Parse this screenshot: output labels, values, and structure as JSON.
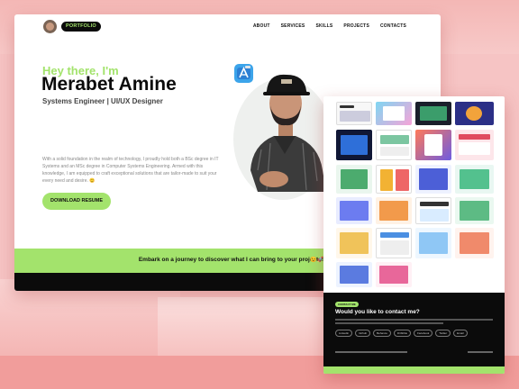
{
  "nav": {
    "brand": "PORTFOLIO",
    "links": [
      "ABOUT",
      "SERVICES",
      "SKILLS",
      "PROJECTS",
      "CONTACTS"
    ]
  },
  "hero": {
    "greeting": "Hey there, I'm",
    "name": "Merabet Amine",
    "role": "Systems Engineer | UI/UX Designer",
    "bio": "With a solid foundation in the realm of technology, I proudly hold both a BSc degree in IT Systems and an MSc degree in Computer Systems Engineering. Armed with this knowledge, I am equipped to craft exceptional solutions that are tailor-made to suit your every need and desire. 😊",
    "download_label": "DOWNLOAD RESUME"
  },
  "banner": {
    "text": "Embark on a journey to discover what I can bring to your projects!",
    "emoji": "😉🚀"
  },
  "contact": {
    "badge": "CONTACT ME",
    "title": "Would you like to contact me?",
    "links": [
      "Linkedin",
      "Github",
      "Behance",
      "Dribbble",
      "Facebook",
      "Twitter",
      "Email"
    ]
  },
  "colors": {
    "accent": "#a3e36c",
    "dark": "#0b0b0b",
    "backdrop": "#f6c4c4"
  },
  "icons": {
    "app_icon": "xcode-icon"
  }
}
